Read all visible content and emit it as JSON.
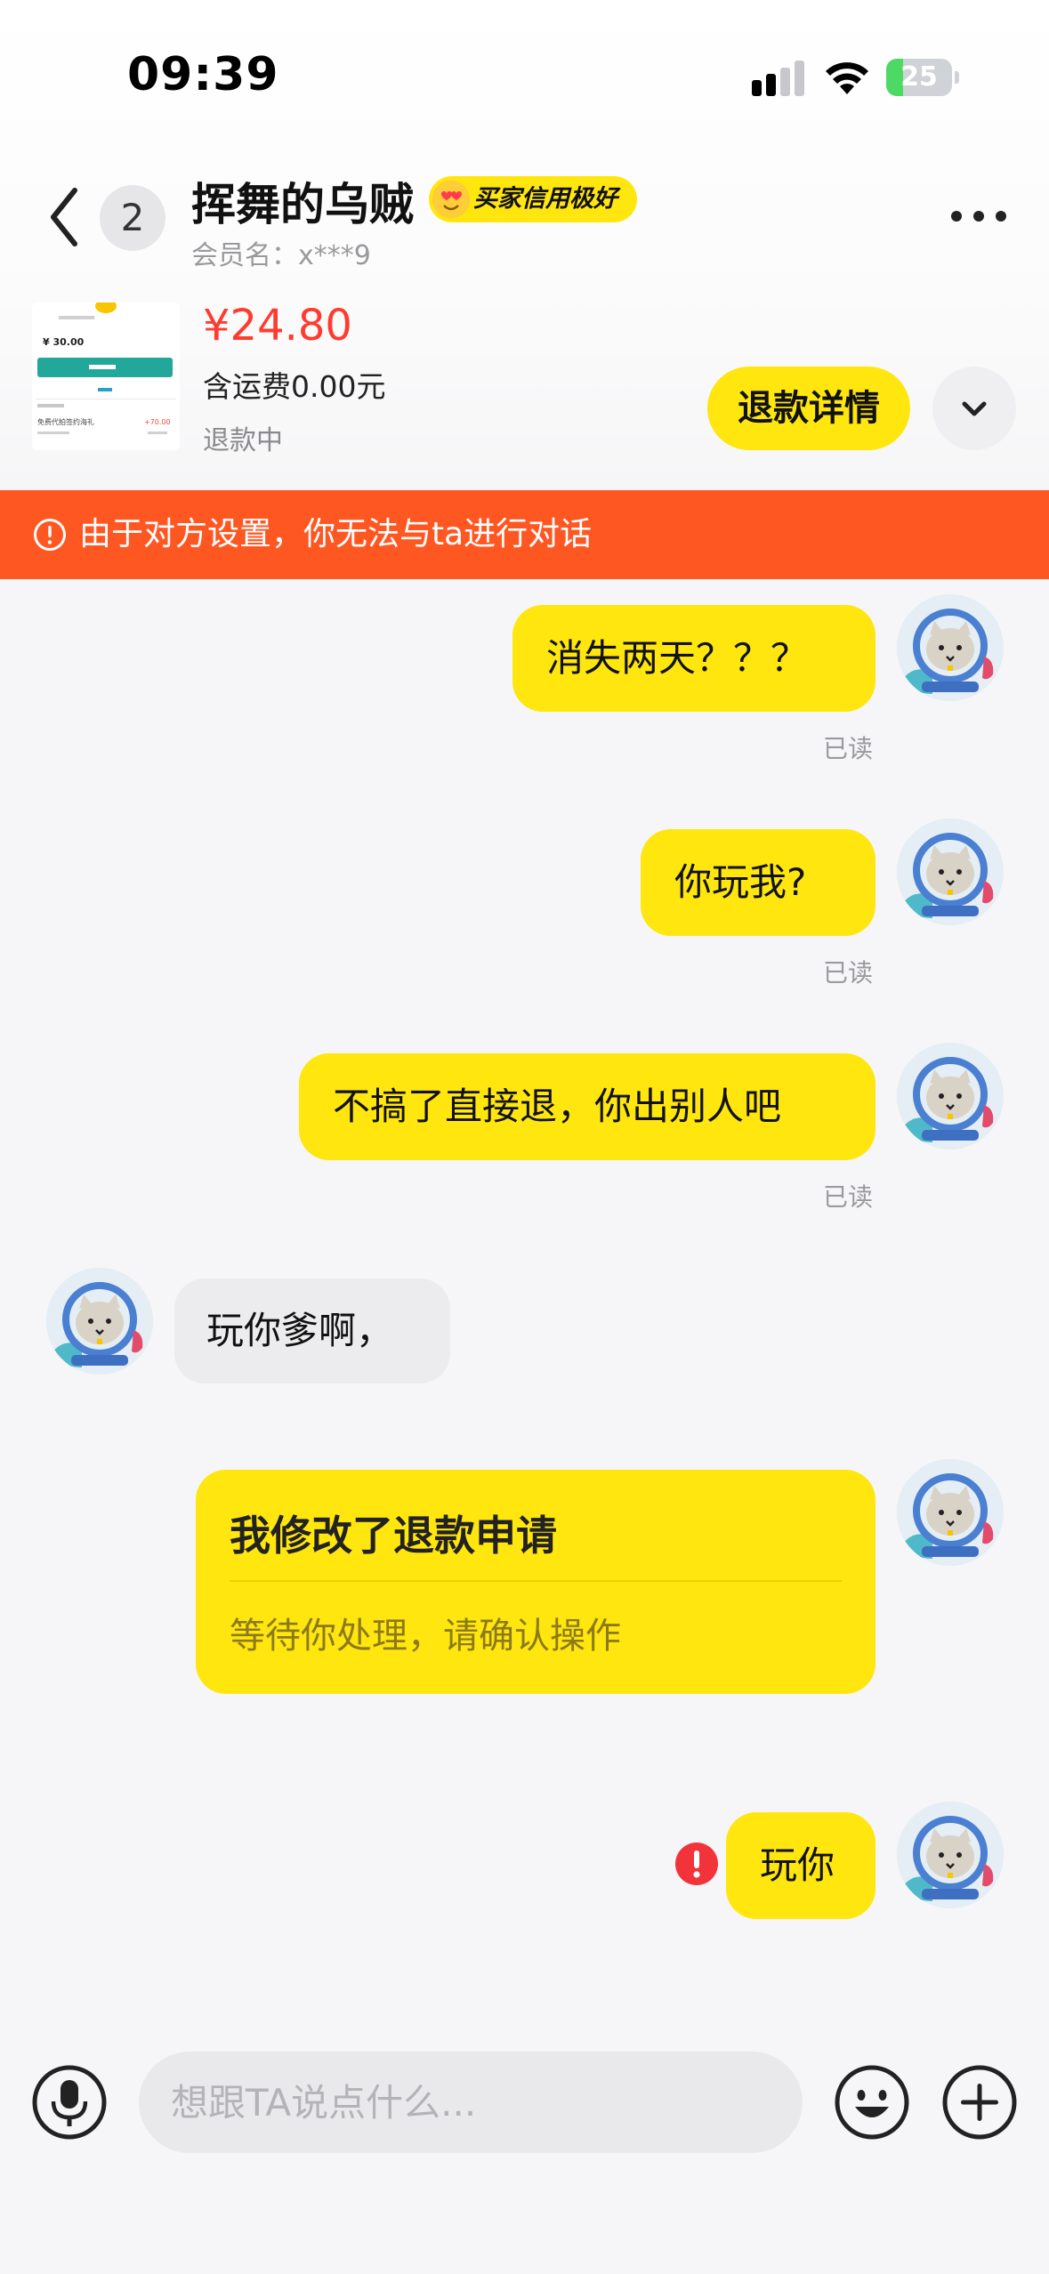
{
  "status_bar": {
    "time": "09:39",
    "battery": "25",
    "battery_level": 0.25
  },
  "header": {
    "unread_count": "2",
    "contact_name": "挥舞的乌贼",
    "credit_badge": "买家信用极好",
    "member_name": "会员名：x***9"
  },
  "order": {
    "price": "¥24.80",
    "shipping": "含运费0.00元",
    "status": "退款中",
    "refund_button": "退款详情",
    "thumbnail": {
      "amount": "¥ 30.00",
      "item_title": "免费代拍签约海礼",
      "item_amount": "+70.00"
    }
  },
  "banner": {
    "text": "由于对方设置，你无法与ta进行对话"
  },
  "messages": [
    {
      "sender": "me",
      "text": "消失两天？？？",
      "status": "已读"
    },
    {
      "sender": "me",
      "text": "你玩我?",
      "status": "已读"
    },
    {
      "sender": "me",
      "text": "不搞了直接退，你出别人吧",
      "status": "已读"
    },
    {
      "sender": "them",
      "text": "玩你爹啊，"
    },
    {
      "sender": "me",
      "type": "card",
      "title": "我修改了退款申请",
      "subtitle": "等待你处理，请确认操作"
    },
    {
      "sender": "me",
      "text": "玩你",
      "failed": true
    }
  ],
  "input": {
    "placeholder": "想跟TA说点什么..."
  },
  "colors": {
    "accent": "#ffe60f",
    "banner": "#ff5722",
    "price": "#ff3b30"
  }
}
